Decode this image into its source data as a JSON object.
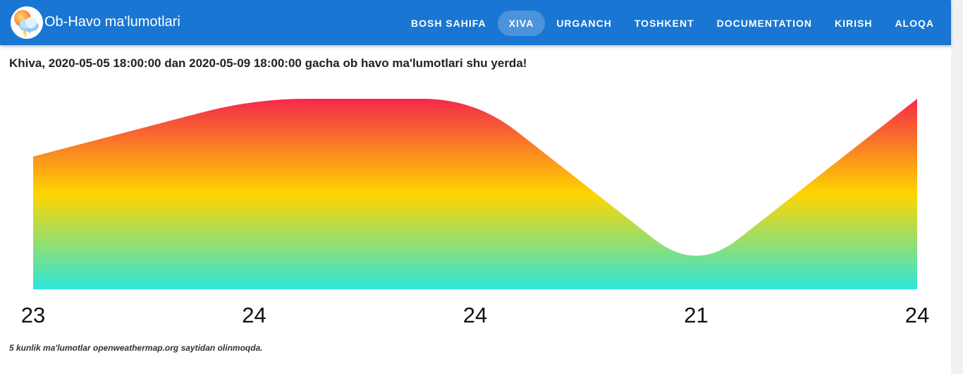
{
  "navbar": {
    "brand": "Ob-Havo ma'lumotlari",
    "logo_icon": "weather-cloud-icon",
    "items": [
      {
        "label": "BOSH SAHIFA",
        "active": false
      },
      {
        "label": "XIVA",
        "active": true
      },
      {
        "label": "URGANCH",
        "active": false
      },
      {
        "label": "TOSHKENT",
        "active": false
      },
      {
        "label": "DOCUMENTATION",
        "active": false
      },
      {
        "label": "KIRISH",
        "active": false
      },
      {
        "label": "ALOQA",
        "active": false
      }
    ],
    "color": "#1976d2"
  },
  "page_title": "Khiva, 2020-05-05 18:00:00 dan 2020-05-09 18:00:00 gacha ob havo ma'lumotlari shu yerda!",
  "chart_data": {
    "type": "area",
    "categories": [
      "23",
      "24",
      "24",
      "21",
      "24"
    ],
    "values": [
      23,
      24,
      24,
      21,
      24
    ],
    "ylim": [
      20.7,
      24
    ],
    "smooth": true,
    "gradient": [
      "#f5284a",
      "#ffd600",
      "#2de6dc"
    ],
    "grid": false,
    "legend": "none"
  },
  "footnote": "5 kunlik ma'lumotlar openweathermap.org saytidan olinmoqda."
}
